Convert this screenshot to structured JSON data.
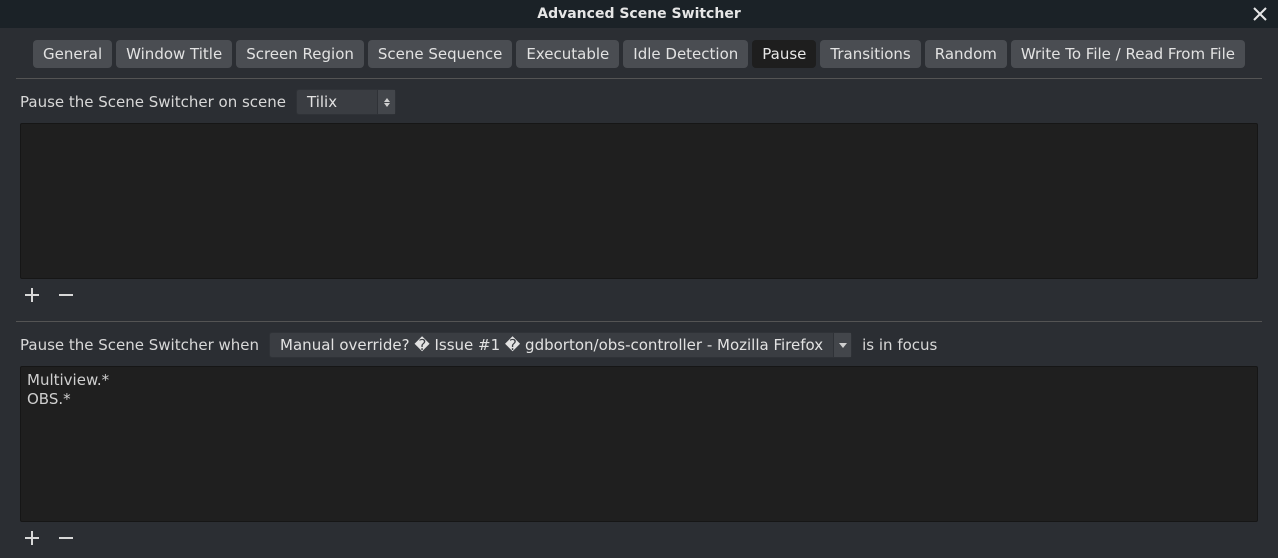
{
  "window": {
    "title": "Advanced Scene Switcher"
  },
  "tabs": [
    {
      "label": "General"
    },
    {
      "label": "Window Title"
    },
    {
      "label": "Screen Region"
    },
    {
      "label": "Scene Sequence"
    },
    {
      "label": "Executable"
    },
    {
      "label": "Idle Detection"
    },
    {
      "label": "Pause",
      "active": true
    },
    {
      "label": "Transitions"
    },
    {
      "label": "Random"
    },
    {
      "label": "Write To File / Read From File"
    }
  ],
  "pauseOnScene": {
    "label": "Pause the Scene Switcher on scene",
    "selected": "Tilix",
    "items": []
  },
  "pauseWhen": {
    "label_before": "Pause the Scene Switcher when",
    "selected": "Manual override? � Issue #1 � gdborton/obs-controller - Mozilla Firefox",
    "label_after": "is in focus",
    "items": [
      "Multiview.*",
      "OBS.*"
    ]
  }
}
